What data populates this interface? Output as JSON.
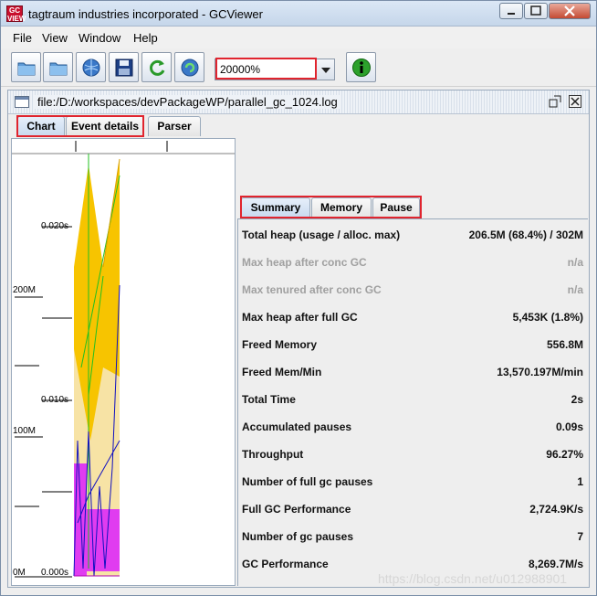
{
  "window": {
    "title": "tagtraum industries incorporated - GCViewer",
    "icon_text": "GC\nVIEWER",
    "controls": [
      "minimize",
      "maximize",
      "close"
    ]
  },
  "menu": [
    "File",
    "View",
    "Window",
    "Help"
  ],
  "toolbar": {
    "buttons": [
      {
        "name": "open-file",
        "icon": "folder-icon"
      },
      {
        "name": "open-recent",
        "icon": "folder-icon"
      },
      {
        "name": "open-url",
        "icon": "globe-icon"
      },
      {
        "name": "export",
        "icon": "disk-icon"
      },
      {
        "name": "refresh",
        "icon": "refresh-icon"
      },
      {
        "name": "watch",
        "icon": "watch-icon"
      }
    ],
    "zoom_value": "20000%",
    "info_icon": "info-icon"
  },
  "document": {
    "title": "file:/D:/workspaces/devPackageWP/parallel_gc_1024.log",
    "tabs": [
      "Chart",
      "Event details",
      "Parser"
    ],
    "active_tab": "Chart"
  },
  "chart": {
    "left_labels": [
      "0.020s",
      "200M",
      "0.010s",
      "100M",
      "0M",
      "0.000s"
    ],
    "colors": {
      "heap": "#f7c400",
      "tenured": "#f7e3a5",
      "young": "#e03cf0",
      "gc_line": "#20c020",
      "pause_line": "#1010c0"
    }
  },
  "summary": {
    "tabs": [
      "Summary",
      "Memory",
      "Pause"
    ],
    "active_tab": "Summary",
    "rows": [
      {
        "label": "Total heap (usage / alloc. max)",
        "value": "206.5M (68.4%) / 302M",
        "dim": false
      },
      {
        "label": "Max heap after conc GC",
        "value": "n/a",
        "dim": true
      },
      {
        "label": "Max tenured after conc GC",
        "value": "n/a",
        "dim": true
      },
      {
        "label": "Max heap after full GC",
        "value": "5,453K (1.8%)",
        "dim": false
      },
      {
        "label": "Freed Memory",
        "value": "556.8M",
        "dim": false
      },
      {
        "label": "Freed Mem/Min",
        "value": "13,570.197M/min",
        "dim": false
      },
      {
        "label": "Total Time",
        "value": "2s",
        "dim": false
      },
      {
        "label": "Accumulated pauses",
        "value": "0.09s",
        "dim": false
      },
      {
        "label": "Throughput",
        "value": "96.27%",
        "dim": false
      },
      {
        "label": "Number of full gc pauses",
        "value": "1",
        "dim": false
      },
      {
        "label": "Full GC Performance",
        "value": "2,724.9K/s",
        "dim": false
      },
      {
        "label": "Number of gc pauses",
        "value": "7",
        "dim": false
      },
      {
        "label": "GC Performance",
        "value": "8,269.7M/s",
        "dim": false
      }
    ]
  },
  "watermark": "https://blog.csdn.net/u012988901"
}
